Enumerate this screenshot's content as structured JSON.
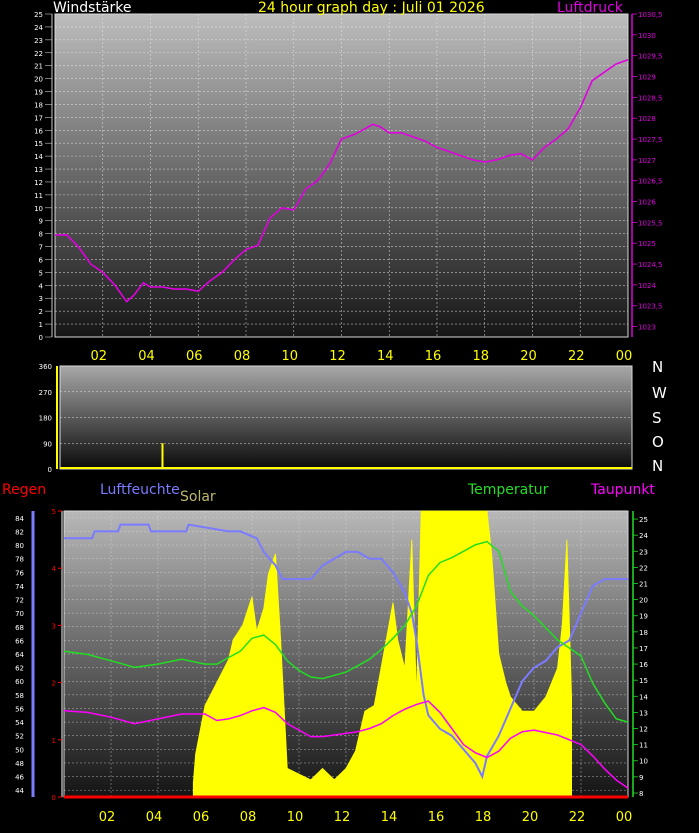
{
  "header": {
    "left_label": "Windstärke",
    "title": "24 hour graph day : Juli 01 2026",
    "right_label": "Luftdruck"
  },
  "panel2": {
    "compass": [
      "N",
      "W",
      "S",
      "O",
      "N"
    ]
  },
  "panel3": {
    "labels": {
      "rain": "Regen",
      "humidity": "Luftfeuchte",
      "solar": "Solar",
      "temperature": "Temperatur",
      "dewpoint": "Taupunkt"
    }
  },
  "colors": {
    "pressure": "#e000e0",
    "wind_dir": "#ffff00",
    "humidity": "#7b7bff",
    "solar": "#ffff00",
    "temperature": "#22dd22",
    "dewpoint": "#ff00ff",
    "rain": "#ff0000",
    "axis_yellow": "#ffff00",
    "frame": "#d8d8d8"
  },
  "chart_data": [
    {
      "type": "line",
      "panel": "pressure",
      "x_ticks": [
        "02",
        "04",
        "06",
        "08",
        "10",
        "12",
        "14",
        "16",
        "18",
        "20",
        "22",
        "00"
      ],
      "y_left": {
        "range": [
          0,
          25
        ],
        "ticks": [
          "0",
          "1",
          "2",
          "3",
          "4",
          "5",
          "6",
          "7",
          "8",
          "9",
          "10",
          "11",
          "12",
          "13",
          "14",
          "15",
          "16",
          "17",
          "18",
          "19",
          "20",
          "21",
          "22",
          "23",
          "24",
          "25"
        ]
      },
      "y_right": {
        "range": [
          1022.75,
          1030.5
        ],
        "ticks": [
          "1023",
          "1023,5",
          "1024",
          "1024,5",
          "1025",
          "1025,5",
          "1026",
          "1026,5",
          "1027",
          "1027,5",
          "1028",
          "1028,5",
          "1029",
          "1029,5",
          "1030",
          "1030,5"
        ]
      },
      "series": [
        {
          "axis": "right",
          "x": [
            0,
            0.5,
            1,
            1.5,
            2,
            2.5,
            3,
            3.3,
            3.7,
            4,
            4.5,
            5,
            5.5,
            6,
            6.5,
            7,
            7.5,
            8,
            8.5,
            9,
            9.5,
            10,
            10.5,
            11,
            11.5,
            12,
            12.5,
            13,
            13.3,
            13.6,
            14,
            14.5,
            15,
            15.5,
            16,
            16.5,
            17,
            17.5,
            18,
            18.5,
            19,
            19.5,
            20,
            20.5,
            21,
            21.5,
            22,
            22.5,
            23,
            23.5,
            24
          ],
          "y": [
            1025.2,
            1025.2,
            1024.9,
            1024.5,
            1024.3,
            1024,
            1023.6,
            1023.75,
            1024.05,
            1023.95,
            1023.95,
            1023.9,
            1023.9,
            1023.85,
            1024.1,
            1024.3,
            1024.6,
            1024.85,
            1024.95,
            1025.6,
            1025.85,
            1025.8,
            1026.3,
            1026.5,
            1026.9,
            1027.5,
            1027.6,
            1027.75,
            1027.85,
            1027.8,
            1027.65,
            1027.65,
            1027.55,
            1027.45,
            1027.3,
            1027.2,
            1027.1,
            1027.0,
            1026.95,
            1027.0,
            1027.1,
            1027.15,
            1027.0,
            1027.3,
            1027.5,
            1027.75,
            1028.25,
            1028.9,
            1029.1,
            1029.3,
            1029.4
          ]
        }
      ]
    },
    {
      "type": "bar",
      "panel": "wind_direction",
      "x_ticks": [
        "02",
        "04",
        "06",
        "08",
        "10",
        "12",
        "14",
        "16",
        "18",
        "20",
        "22",
        "00"
      ],
      "y_range": [
        0,
        360
      ],
      "y_ticks": [
        "0",
        "90",
        "180",
        "270",
        "360"
      ],
      "series": [
        {
          "x": [
            4.3
          ],
          "values": [
            90
          ]
        }
      ]
    },
    {
      "type": "line",
      "panel": "weather",
      "x_ticks": [
        "02",
        "04",
        "06",
        "08",
        "10",
        "12",
        "14",
        "16",
        "18",
        "20",
        "22",
        "00"
      ],
      "y_left_humidity": {
        "range": [
          43,
          85
        ],
        "ticks": [
          "44",
          "46",
          "48",
          "50",
          "52",
          "54",
          "56",
          "58",
          "60",
          "62",
          "64",
          "66",
          "68",
          "70",
          "72",
          "74",
          "76",
          "78",
          "80",
          "82",
          "84"
        ]
      },
      "y_left_rain": {
        "range": [
          0,
          5
        ],
        "ticks": [
          "0",
          "1",
          "2",
          "3",
          "4",
          "5"
        ]
      },
      "y_right_temperature": {
        "range": [
          7.75,
          25.5
        ],
        "ticks": [
          "8",
          "9",
          "10",
          "11",
          "12",
          "13",
          "14",
          "15",
          "16",
          "17",
          "18",
          "19",
          "20",
          "21",
          "22",
          "23",
          "24",
          "25"
        ]
      },
      "series": [
        {
          "key": "humidity",
          "axis": "humidity",
          "x": [
            0,
            0.1,
            1.2,
            1.3,
            2.3,
            2.4,
            3.6,
            3.7,
            5.2,
            5.3,
            7,
            7.5,
            8.2,
            8.5,
            9,
            9.3,
            9.6,
            10,
            10.5,
            11,
            11.5,
            12,
            12.5,
            13,
            13.5,
            14,
            14.5,
            14.8,
            15,
            15.3,
            15.5,
            16,
            16.5,
            17,
            17.5,
            17.8,
            18,
            18.5,
            19,
            19.5,
            20,
            20.5,
            21,
            21.5,
            22,
            22.5,
            23,
            23.5,
            24
          ],
          "y": [
            81,
            81,
            81,
            82,
            82,
            83,
            83,
            82,
            82,
            83,
            82,
            82,
            81,
            79,
            77,
            75,
            75,
            75,
            75,
            77,
            78,
            79,
            79,
            78,
            78,
            76,
            73,
            70,
            66,
            58,
            55,
            53,
            52,
            50,
            48,
            46,
            49,
            52,
            56,
            60,
            62,
            63,
            65,
            66,
            70,
            74,
            75,
            75,
            75
          ]
        },
        {
          "key": "temperature",
          "axis": "temperature",
          "x": [
            0,
            1,
            2,
            3,
            4,
            5,
            6,
            6.5,
            7,
            7.5,
            8,
            8.5,
            9,
            9.5,
            10,
            10.5,
            11,
            11.5,
            12,
            12.5,
            13,
            13.5,
            14,
            14.5,
            15,
            15.5,
            16,
            16.5,
            17,
            17.5,
            18,
            18.5,
            19,
            19.5,
            20,
            21,
            22,
            22.5,
            23,
            23.5,
            24
          ],
          "y": [
            16.8,
            16.6,
            16.2,
            15.8,
            16.0,
            16.3,
            16.0,
            16.0,
            16.4,
            16.8,
            17.6,
            17.8,
            17.2,
            16.2,
            15.6,
            15.2,
            15.1,
            15.3,
            15.5,
            15.9,
            16.3,
            16.9,
            17.6,
            18.4,
            19.6,
            21.5,
            22.3,
            22.6,
            23.0,
            23.4,
            23.6,
            23.0,
            20.5,
            19.6,
            19.0,
            17.5,
            16.5,
            14.8,
            13.6,
            12.6,
            12.4
          ]
        },
        {
          "key": "dewpoint",
          "axis": "temperature",
          "x": [
            0,
            1,
            2,
            3,
            4,
            5,
            6,
            6.5,
            7,
            7.5,
            8,
            8.5,
            9,
            9.5,
            10,
            10.5,
            11,
            11.5,
            12,
            12.5,
            13,
            13.5,
            14,
            14.5,
            15,
            15.5,
            16,
            16.5,
            17,
            17.5,
            18,
            18.5,
            19,
            19.5,
            20,
            21,
            22,
            22.5,
            23,
            23.5,
            24
          ],
          "y": [
            13.1,
            13.0,
            12.7,
            12.3,
            12.6,
            12.9,
            12.9,
            12.5,
            12.6,
            12.8,
            13.1,
            13.3,
            13.0,
            12.3,
            11.9,
            11.5,
            11.5,
            11.6,
            11.7,
            11.8,
            12.0,
            12.3,
            12.8,
            13.2,
            13.5,
            13.7,
            13.0,
            12.0,
            11.0,
            10.5,
            10.2,
            10.6,
            11.4,
            11.8,
            11.9,
            11.6,
            11.0,
            10.3,
            9.5,
            8.8,
            8.3
          ]
        },
        {
          "key": "rain",
          "axis": "rain",
          "x": [
            0,
            24
          ],
          "y": [
            0,
            0
          ]
        },
        {
          "key": "solar",
          "axis": "solar_relative",
          "x": [
            5.5,
            5.6,
            6,
            6.5,
            7,
            7.2,
            7.6,
            8,
            8.2,
            8.5,
            8.7,
            9,
            9.2,
            9.5,
            10,
            10.5,
            11,
            11.5,
            12,
            12.4,
            12.8,
            13.2,
            13.6,
            14,
            14.2,
            14.5,
            14.8,
            15,
            15.2,
            15.5,
            16,
            16.5,
            17,
            17.5,
            18,
            18.2,
            18.5,
            18.8,
            19,
            19.5,
            20,
            20.5,
            21,
            21.2,
            21.4,
            21.6
          ],
          "y": [
            0.05,
            0.15,
            0.32,
            0.4,
            0.48,
            0.55,
            0.6,
            0.7,
            0.58,
            0.66,
            0.78,
            0.85,
            0.58,
            0.1,
            0.08,
            0.06,
            0.1,
            0.06,
            0.1,
            0.16,
            0.3,
            0.32,
            0.5,
            0.68,
            0.55,
            0.45,
            0.9,
            0.35,
            1.0,
            1.0,
            1.0,
            1.0,
            1.0,
            1.0,
            1.0,
            0.85,
            0.5,
            0.4,
            0.35,
            0.3,
            0.3,
            0.35,
            0.45,
            0.6,
            0.9,
            0.35
          ]
        }
      ]
    }
  ]
}
